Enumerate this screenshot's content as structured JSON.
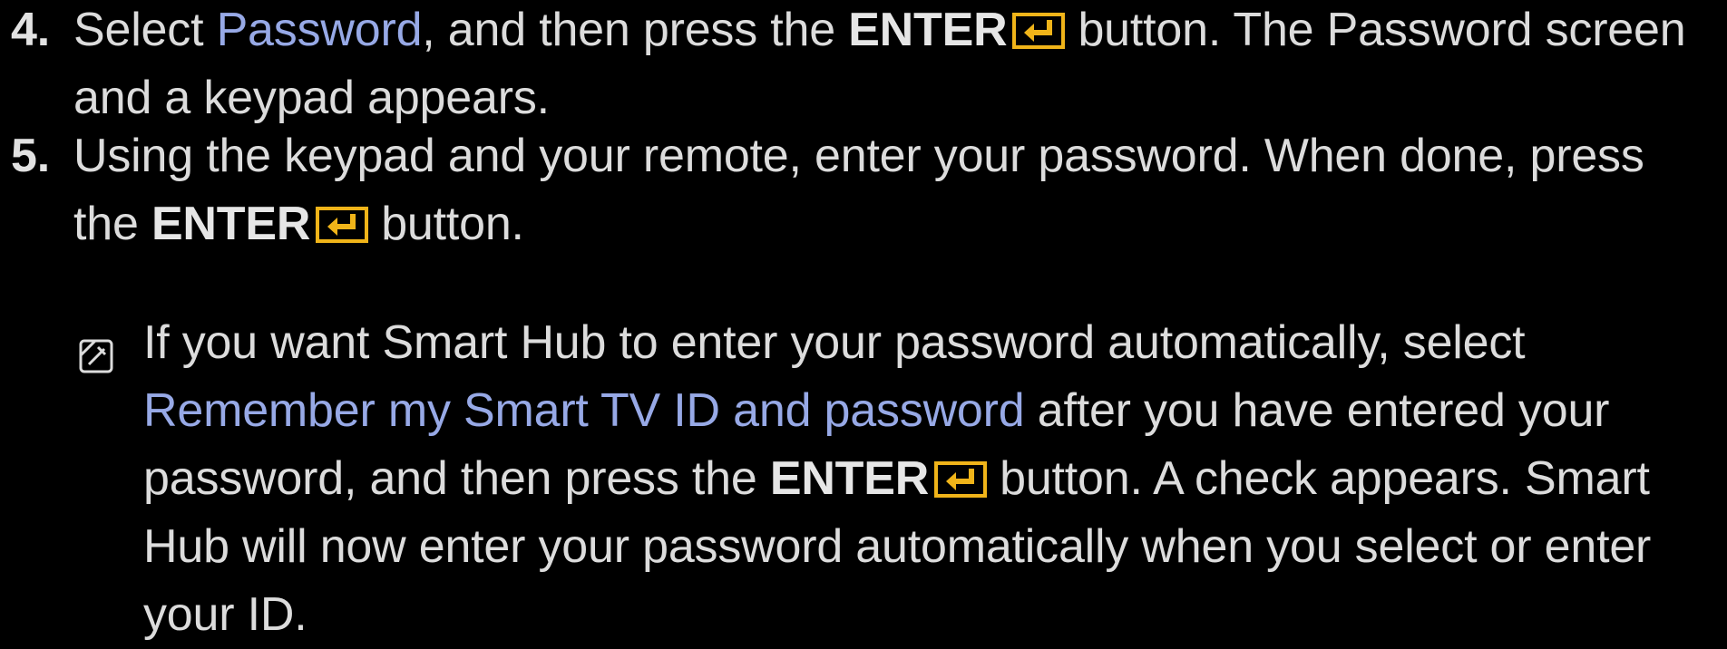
{
  "colors": {
    "background": "#000000",
    "text": "#dcdcdc",
    "highlight": "#97a9e6",
    "enter_icon": "#f0b419"
  },
  "icons": {
    "enter": "enter-key-icon",
    "note": "note-icon"
  },
  "step4": {
    "number": "4.",
    "t1": "Select ",
    "highlight": "Password",
    "t2": ", and then press the ",
    "bold": "ENTER",
    "t3": "button. The Password screen",
    "t4": "and a keypad appears."
  },
  "step5": {
    "number": "5.",
    "t1": "Using the keypad and your remote, enter your password. When done, press",
    "t2": "the ",
    "bold": "ENTER",
    "t3": "button."
  },
  "note": {
    "t1": "If you want Smart Hub to enter your password automatically, select",
    "highlight": "Remember my Smart TV ID and password",
    "t2": " after you have entered your",
    "t3": "password, and then press the ",
    "bold": "ENTER",
    "t4": "button. A check appears. Smart",
    "t5": "Hub will now enter your password automatically when you select or enter",
    "t6": "your ID."
  }
}
